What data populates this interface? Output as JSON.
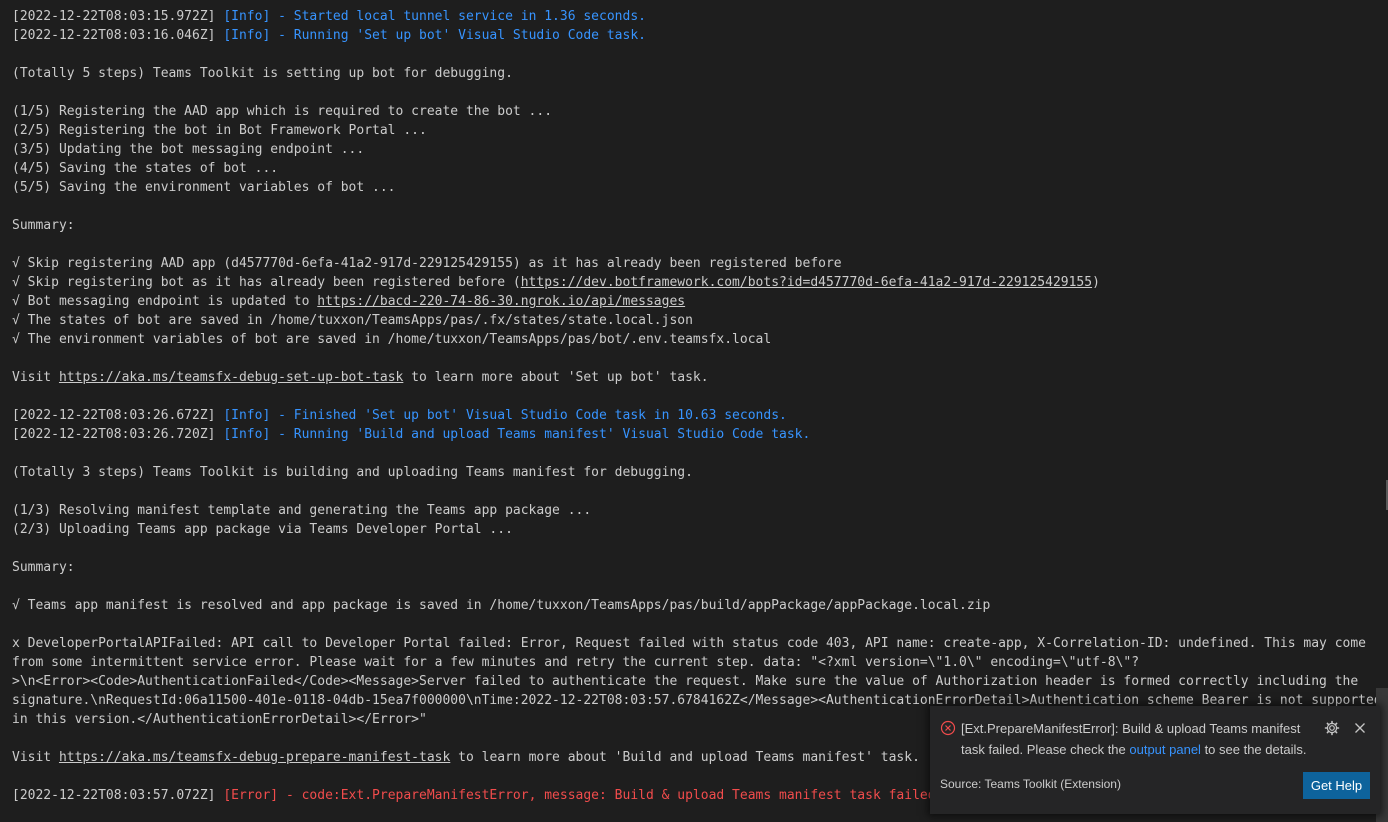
{
  "terminal": {
    "lines": [
      {
        "parts": [
          {
            "text": "[2022-12-22T08:03:15.972Z] ",
            "kind": "ts"
          },
          {
            "text": "[Info] - Started local tunnel service in 1.36 seconds.",
            "kind": "info"
          }
        ]
      },
      {
        "parts": [
          {
            "text": "[2022-12-22T08:03:16.046Z] ",
            "kind": "ts"
          },
          {
            "text": "[Info] - Running 'Set up bot' Visual Studio Code task.",
            "kind": "info"
          }
        ]
      },
      {
        "parts": []
      },
      {
        "parts": [
          {
            "text": "(Totally 5 steps) Teams Toolkit is setting up bot for debugging.",
            "kind": "plain"
          }
        ]
      },
      {
        "parts": []
      },
      {
        "parts": [
          {
            "text": "(1/5) Registering the AAD app which is required to create the bot ...",
            "kind": "plain"
          }
        ]
      },
      {
        "parts": [
          {
            "text": "(2/5) Registering the bot in Bot Framework Portal ...",
            "kind": "plain"
          }
        ]
      },
      {
        "parts": [
          {
            "text": "(3/5) Updating the bot messaging endpoint ...",
            "kind": "plain"
          }
        ]
      },
      {
        "parts": [
          {
            "text": "(4/5) Saving the states of bot ...",
            "kind": "plain"
          }
        ]
      },
      {
        "parts": [
          {
            "text": "(5/5) Saving the environment variables of bot ...",
            "kind": "plain"
          }
        ]
      },
      {
        "parts": []
      },
      {
        "parts": [
          {
            "text": "Summary:",
            "kind": "plain"
          }
        ]
      },
      {
        "parts": []
      },
      {
        "parts": [
          {
            "text": "√ Skip registering AAD app (d457770d-6efa-41a2-917d-229125429155) as it has already been registered before",
            "kind": "plain"
          }
        ]
      },
      {
        "parts": [
          {
            "text": "√ Skip registering bot as it has already been registered before (",
            "kind": "plain"
          },
          {
            "text": "https://dev.botframework.com/bots?id=d457770d-6efa-41a2-917d-229125429155",
            "kind": "link"
          },
          {
            "text": ")",
            "kind": "plain"
          }
        ]
      },
      {
        "parts": [
          {
            "text": "√ Bot messaging endpoint is updated to ",
            "kind": "plain"
          },
          {
            "text": "https://bacd-220-74-86-30.ngrok.io/api/messages",
            "kind": "link"
          }
        ]
      },
      {
        "parts": [
          {
            "text": "√ The states of bot are saved in /home/tuxxon/TeamsApps/pas/.fx/states/state.local.json",
            "kind": "plain"
          }
        ]
      },
      {
        "parts": [
          {
            "text": "√ The environment variables of bot are saved in /home/tuxxon/TeamsApps/pas/bot/.env.teamsfx.local",
            "kind": "plain"
          }
        ]
      },
      {
        "parts": []
      },
      {
        "parts": [
          {
            "text": "Visit ",
            "kind": "plain"
          },
          {
            "text": "https://aka.ms/teamsfx-debug-set-up-bot-task",
            "kind": "link"
          },
          {
            "text": " to learn more about 'Set up bot' task.",
            "kind": "plain"
          }
        ]
      },
      {
        "parts": []
      },
      {
        "parts": [
          {
            "text": "[2022-12-22T08:03:26.672Z] ",
            "kind": "ts"
          },
          {
            "text": "[Info] - Finished 'Set up bot' Visual Studio Code task in 10.63 seconds.",
            "kind": "info"
          }
        ]
      },
      {
        "parts": [
          {
            "text": "[2022-12-22T08:03:26.720Z] ",
            "kind": "ts"
          },
          {
            "text": "[Info] - Running 'Build and upload Teams manifest' Visual Studio Code task.",
            "kind": "info"
          }
        ]
      },
      {
        "parts": []
      },
      {
        "parts": [
          {
            "text": "(Totally 3 steps) Teams Toolkit is building and uploading Teams manifest for debugging.",
            "kind": "plain"
          }
        ]
      },
      {
        "parts": []
      },
      {
        "parts": [
          {
            "text": "(1/3) Resolving manifest template and generating the Teams app package ...",
            "kind": "plain"
          }
        ]
      },
      {
        "parts": [
          {
            "text": "(2/3) Uploading Teams app package via Teams Developer Portal ...",
            "kind": "plain"
          }
        ]
      },
      {
        "parts": []
      },
      {
        "parts": [
          {
            "text": "Summary:",
            "kind": "plain"
          }
        ]
      },
      {
        "parts": []
      },
      {
        "parts": [
          {
            "text": "√ Teams app manifest is resolved and app package is saved in /home/tuxxon/TeamsApps/pas/build/appPackage/appPackage.local.zip",
            "kind": "plain"
          }
        ]
      },
      {
        "parts": []
      },
      {
        "parts": [
          {
            "text": "x DeveloperPortalAPIFailed: API call to Developer Portal failed: Error, Request failed with status code 403, API name: create-app, X-Correlation-ID: undefined. This may come",
            "kind": "plain"
          }
        ]
      },
      {
        "parts": [
          {
            "text": "from some intermittent service error. Please wait for a few minutes and retry the current step. data: \"<?xml version=\\\"1.0\\\" encoding=\\\"utf-8\\\"?",
            "kind": "plain"
          }
        ]
      },
      {
        "parts": [
          {
            "text": ">\\n<Error><Code>AuthenticationFailed</Code><Message>Server failed to authenticate the request. Make sure the value of Authorization header is formed correctly including the",
            "kind": "plain"
          }
        ]
      },
      {
        "parts": [
          {
            "text": "signature.\\nRequestId:06a11500-401e-0118-04db-15ea7f000000\\nTime:2022-12-22T08:03:57.6784162Z</Message><AuthenticationErrorDetail>Authentication scheme Bearer is not supported",
            "kind": "plain"
          }
        ]
      },
      {
        "parts": [
          {
            "text": "in this version.</AuthenticationErrorDetail></Error>\"",
            "kind": "plain"
          }
        ]
      },
      {
        "parts": []
      },
      {
        "parts": [
          {
            "text": "Visit ",
            "kind": "plain"
          },
          {
            "text": "https://aka.ms/teamsfx-debug-prepare-manifest-task",
            "kind": "link"
          },
          {
            "text": " to learn more about 'Build and upload Teams manifest' task.",
            "kind": "plain"
          }
        ]
      },
      {
        "parts": []
      },
      {
        "parts": [
          {
            "text": "[2022-12-22T08:03:57.072Z] ",
            "kind": "ts"
          },
          {
            "text": "[Error] - code:Ext.PrepareManifestError, message: Build & upload Teams manifest task failed.",
            "kind": "err"
          }
        ]
      }
    ]
  },
  "notification": {
    "message_prefix": "[Ext.PrepareManifestError]: Build & upload Teams manifest task failed. Please check the ",
    "message_link": "output panel",
    "message_suffix": " to see the details.",
    "source": "Source: Teams Toolkit (Extension)",
    "button_label": "Get Help",
    "icons": {
      "status": "error-icon",
      "settings": "gear-icon",
      "close": "close-icon"
    },
    "colors": {
      "error": "#f14c4c",
      "button": "#0e639c",
      "link": "#3794ff"
    }
  }
}
